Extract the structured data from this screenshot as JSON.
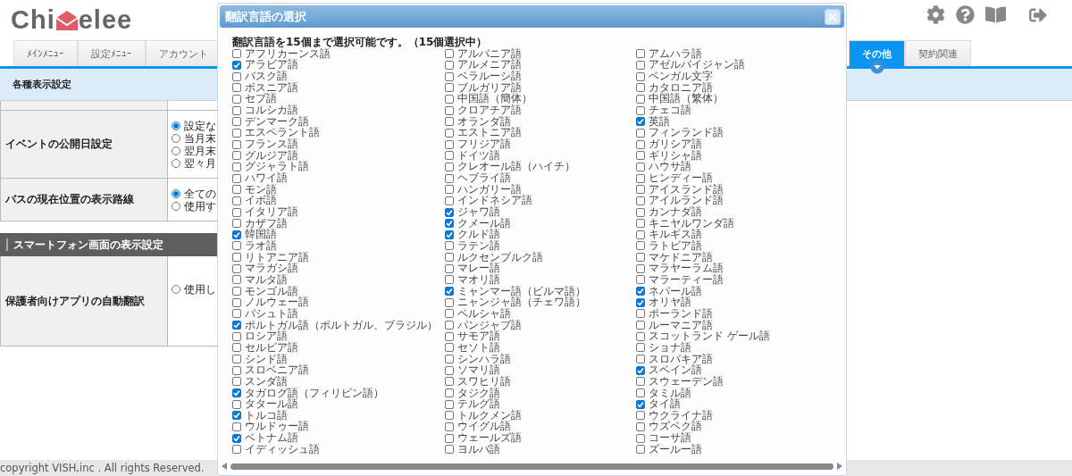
{
  "logo": {
    "before": "Chi",
    "after": "elee"
  },
  "tabs_left": [
    {
      "label": "ﾒｲﾝﾒﾆｭｰ",
      "selected": false
    },
    {
      "label": "設定ﾒﾆｭｰ",
      "selected": false
    },
    {
      "label": "アカウント",
      "selected": false
    }
  ],
  "tabs_right": [
    {
      "label": "その他",
      "selected": true
    },
    {
      "label": "契約関連",
      "selected": false
    }
  ],
  "section_bar": {
    "title": "各種表示設定"
  },
  "settings": [
    {
      "label": "イベントの公開日設定",
      "options": [
        {
          "label": "設定な",
          "selected": true
        },
        {
          "label": "当月末",
          "selected": false
        },
        {
          "label": "翌月末",
          "selected": false
        },
        {
          "label": "翌々月",
          "selected": false
        }
      ]
    },
    {
      "label": "バスの現在位置の表示路線",
      "options": [
        {
          "label": "全ての",
          "selected": true
        },
        {
          "label": "使用す",
          "selected": false
        }
      ]
    }
  ],
  "smartphone_section": {
    "title": "スマートフォン画面の表示設定",
    "settings": [
      {
        "label": "保護者向けアプリの自動翻訳",
        "options": [
          {
            "label": "使用し",
            "selected": false
          }
        ]
      }
    ]
  },
  "footer": "copyright VISH,inc . All rights Reserved.",
  "dialog": {
    "title": "翻訳言語の選択",
    "note": "翻訳言語を15個まで選択可能です。（15個選択中）",
    "columns": [
      [
        {
          "label": "アフリカーンス語",
          "checked": false
        },
        {
          "label": "アラビア語",
          "checked": true
        },
        {
          "label": "バスク語",
          "checked": false
        },
        {
          "label": "ボスニア語",
          "checked": false
        },
        {
          "label": "セブ語",
          "checked": false
        },
        {
          "label": "コルシカ語",
          "checked": false
        },
        {
          "label": "デンマーク語",
          "checked": false
        },
        {
          "label": "エスペラント語",
          "checked": false
        },
        {
          "label": "フランス語",
          "checked": false
        },
        {
          "label": "グルジア語",
          "checked": false
        },
        {
          "label": "グジャラト語",
          "checked": false
        },
        {
          "label": "ハワイ語",
          "checked": false
        },
        {
          "label": "モン語",
          "checked": false
        },
        {
          "label": "イボ語",
          "checked": false
        },
        {
          "label": "イタリア語",
          "checked": false
        },
        {
          "label": "カザフ語",
          "checked": false
        },
        {
          "label": "韓国語",
          "checked": true
        },
        {
          "label": "ラオ語",
          "checked": false
        },
        {
          "label": "リトアニア語",
          "checked": false
        },
        {
          "label": "マラガシ語",
          "checked": false
        },
        {
          "label": "マルタ語",
          "checked": false
        },
        {
          "label": "モンゴル語",
          "checked": false
        },
        {
          "label": "ノルウェー語",
          "checked": false
        },
        {
          "label": "パシュト語",
          "checked": false
        },
        {
          "label": "ポルトガル語（ポルトガル、ブラジル）",
          "checked": true
        },
        {
          "label": "ロシア語",
          "checked": false
        },
        {
          "label": "セルビア語",
          "checked": false
        },
        {
          "label": "シンド語",
          "checked": false
        },
        {
          "label": "スロベニア語",
          "checked": false
        },
        {
          "label": "スンダ語",
          "checked": false
        },
        {
          "label": "タガログ語（フィリピン語）",
          "checked": true
        },
        {
          "label": "タタール語",
          "checked": false
        },
        {
          "label": "トルコ語",
          "checked": true
        },
        {
          "label": "ウルドゥー語",
          "checked": false
        },
        {
          "label": "ベトナム語",
          "checked": true
        },
        {
          "label": "イディッシュ語",
          "checked": false
        }
      ],
      [
        {
          "label": "アルバニア語",
          "checked": false
        },
        {
          "label": "アルメニア語",
          "checked": false
        },
        {
          "label": "ベラルーシ語",
          "checked": false
        },
        {
          "label": "ブルガリア語",
          "checked": false
        },
        {
          "label": "中国語（簡体）",
          "checked": false
        },
        {
          "label": "クロアチア語",
          "checked": false
        },
        {
          "label": "オランダ語",
          "checked": false
        },
        {
          "label": "エストニア語",
          "checked": false
        },
        {
          "label": "フリジア語",
          "checked": false
        },
        {
          "label": "ドイツ語",
          "checked": false
        },
        {
          "label": "クレオール語（ハイチ）",
          "checked": false
        },
        {
          "label": "ヘブライ語",
          "checked": false
        },
        {
          "label": "ハンガリー語",
          "checked": false
        },
        {
          "label": "インドネシア語",
          "checked": false
        },
        {
          "label": "ジャワ語",
          "checked": true
        },
        {
          "label": "クメール語",
          "checked": true
        },
        {
          "label": "クルド語",
          "checked": true
        },
        {
          "label": "ラテン語",
          "checked": false
        },
        {
          "label": "ルクセンブルク語",
          "checked": false
        },
        {
          "label": "マレー語",
          "checked": false
        },
        {
          "label": "マオリ語",
          "checked": false
        },
        {
          "label": "ミャンマー語（ビルマ語）",
          "checked": true
        },
        {
          "label": "ニャンジャ語（チェワ語）",
          "checked": false
        },
        {
          "label": "ペルシャ語",
          "checked": false
        },
        {
          "label": "パンジャブ語",
          "checked": false
        },
        {
          "label": "サモア語",
          "checked": false
        },
        {
          "label": "セソト語",
          "checked": false
        },
        {
          "label": "シンハラ語",
          "checked": false
        },
        {
          "label": "ソマリ語",
          "checked": false
        },
        {
          "label": "スワヒリ語",
          "checked": false
        },
        {
          "label": "タジク語",
          "checked": false
        },
        {
          "label": "テルグ語",
          "checked": false
        },
        {
          "label": "トルクメン語",
          "checked": false
        },
        {
          "label": "ウイグル語",
          "checked": false
        },
        {
          "label": "ウェールズ語",
          "checked": false
        },
        {
          "label": "ヨルバ語",
          "checked": false
        }
      ],
      [
        {
          "label": "アムハラ語",
          "checked": false
        },
        {
          "label": "アゼルバイジャン語",
          "checked": false
        },
        {
          "label": "ベンガル文字",
          "checked": false
        },
        {
          "label": "カタロニア語",
          "checked": false
        },
        {
          "label": "中国語（繁体）",
          "checked": false
        },
        {
          "label": "チェコ語",
          "checked": false
        },
        {
          "label": "英語",
          "checked": true
        },
        {
          "label": "フィンランド語",
          "checked": false
        },
        {
          "label": "ガリシア語",
          "checked": false
        },
        {
          "label": "ギリシャ語",
          "checked": false
        },
        {
          "label": "ハウサ語",
          "checked": false
        },
        {
          "label": "ヒンディー語",
          "checked": false
        },
        {
          "label": "アイスランド語",
          "checked": false
        },
        {
          "label": "アイルランド語",
          "checked": false
        },
        {
          "label": "カンナダ語",
          "checked": false
        },
        {
          "label": "キニヤルワンダ語",
          "checked": false
        },
        {
          "label": "キルギス語",
          "checked": false
        },
        {
          "label": "ラトビア語",
          "checked": false
        },
        {
          "label": "マケドニア語",
          "checked": false
        },
        {
          "label": "マラヤーラム語",
          "checked": false
        },
        {
          "label": "マラーティー語",
          "checked": false
        },
        {
          "label": "ネパール語",
          "checked": true
        },
        {
          "label": "オリヤ語",
          "checked": true
        },
        {
          "label": "ポーランド語",
          "checked": false
        },
        {
          "label": "ルーマニア語",
          "checked": false
        },
        {
          "label": "スコットランド ゲール語",
          "checked": false
        },
        {
          "label": "ショナ語",
          "checked": false
        },
        {
          "label": "スロバキア語",
          "checked": false
        },
        {
          "label": "スペイン語",
          "checked": true
        },
        {
          "label": "スウェーデン語",
          "checked": false
        },
        {
          "label": "タミル語",
          "checked": false
        },
        {
          "label": "タイ語",
          "checked": true
        },
        {
          "label": "ウクライナ語",
          "checked": false
        },
        {
          "label": "ウズベク語",
          "checked": false
        },
        {
          "label": "コーサ語",
          "checked": false
        },
        {
          "label": "ズールー語",
          "checked": false
        }
      ]
    ]
  }
}
